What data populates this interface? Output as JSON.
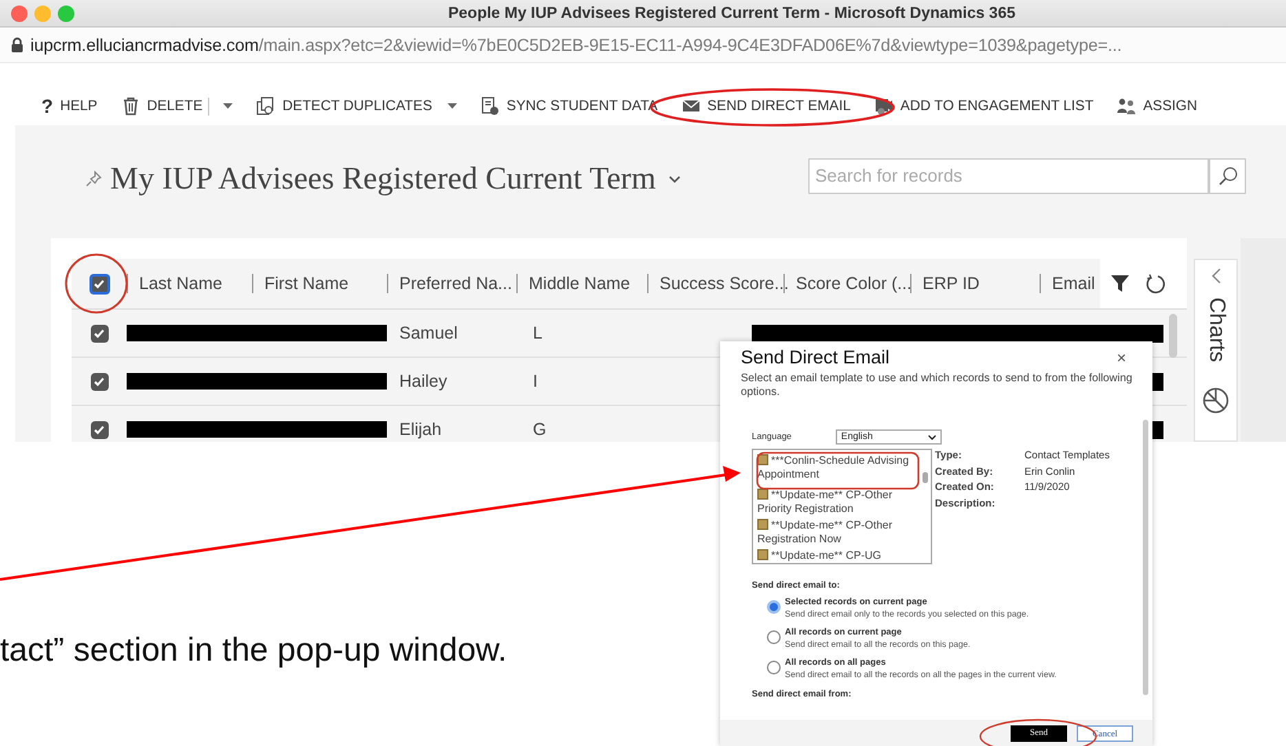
{
  "window": {
    "title": "People My IUP Advisees Registered Current Term - Microsoft Dynamics 365"
  },
  "address_bar": {
    "domain": "iupcrm.elluciancrmadvise.com",
    "path": "/main.aspx?etc=2&viewid=%7bE0C5D2EB-9E15-EC11-A994-9C4E3DFAD06E%7d&viewtype=1039&pagetype=..."
  },
  "toolbar": [
    {
      "glyph": "?",
      "label": "HELP",
      "kind": "plain"
    },
    {
      "label": "DELETE",
      "kind": "split"
    },
    {
      "label": "DETECT DUPLICATES",
      "kind": "dropdown"
    },
    {
      "label": "SYNC STUDENT DATA",
      "kind": "plain"
    },
    {
      "label": "SEND DIRECT EMAIL",
      "kind": "plain"
    },
    {
      "label": "ADD TO ENGAGEMENT LIST",
      "kind": "plain"
    },
    {
      "label": "ASSIGN",
      "kind": "plain"
    }
  ],
  "view": {
    "title": "My IUP Advisees Registered Current Term"
  },
  "search": {
    "placeholder": "Search for records"
  },
  "grid": {
    "header_checked": true,
    "columns": [
      "Last Name",
      "First Name",
      "Preferred Na...",
      "Middle Name",
      "Success Score...",
      "Score Color (...",
      "ERP ID",
      "Email"
    ],
    "rows": [
      {
        "checked": true,
        "preferred_name": "Samuel",
        "middle_name": "L"
      },
      {
        "checked": true,
        "preferred_name": "Hailey",
        "middle_name": "I"
      },
      {
        "checked": true,
        "preferred_name": "Elijah",
        "middle_name": "G"
      }
    ]
  },
  "charts_pane": {
    "label": "Charts"
  },
  "dialog": {
    "title": "Send Direct Email",
    "close": "×",
    "description": "Select an email template to use and which records to send to from the following options.",
    "language": {
      "label": "Language",
      "value": "English"
    },
    "templates": [
      {
        "name": "***Conlin-Schedule Advising Appointment"
      },
      {
        "name": "**Update-me** CP-Other Priority Registration"
      },
      {
        "name": "**Update-me** CP-Other Registration Now"
      },
      {
        "name": "**Update-me** CP-UG"
      }
    ],
    "details": [
      {
        "label": "Type:",
        "value": "Contact Templates"
      },
      {
        "label": "Created By:",
        "value": "Erin Conlin"
      },
      {
        "label": "Created On:",
        "value": "11/9/2020"
      },
      {
        "label": "Description:"
      }
    ],
    "send_to_label": "Send direct email to:",
    "send_to_options": [
      {
        "label": "Selected records on current page",
        "hint": "Send direct email only to the records you selected on this page.",
        "selected": true
      },
      {
        "label": "All records on current page",
        "hint": "Send direct email to all the records on this page.",
        "selected": false
      },
      {
        "label": "All records on all pages",
        "hint": "Send direct email to all the records on all the pages in the current view.",
        "selected": false
      }
    ],
    "send_from_label": "Send direct email from:",
    "buttons": [
      {
        "label": "Send",
        "kind": "primary"
      },
      {
        "label": "Cancel",
        "kind": "secondary"
      }
    ]
  },
  "caption": "tact” section in the pop-up window."
}
